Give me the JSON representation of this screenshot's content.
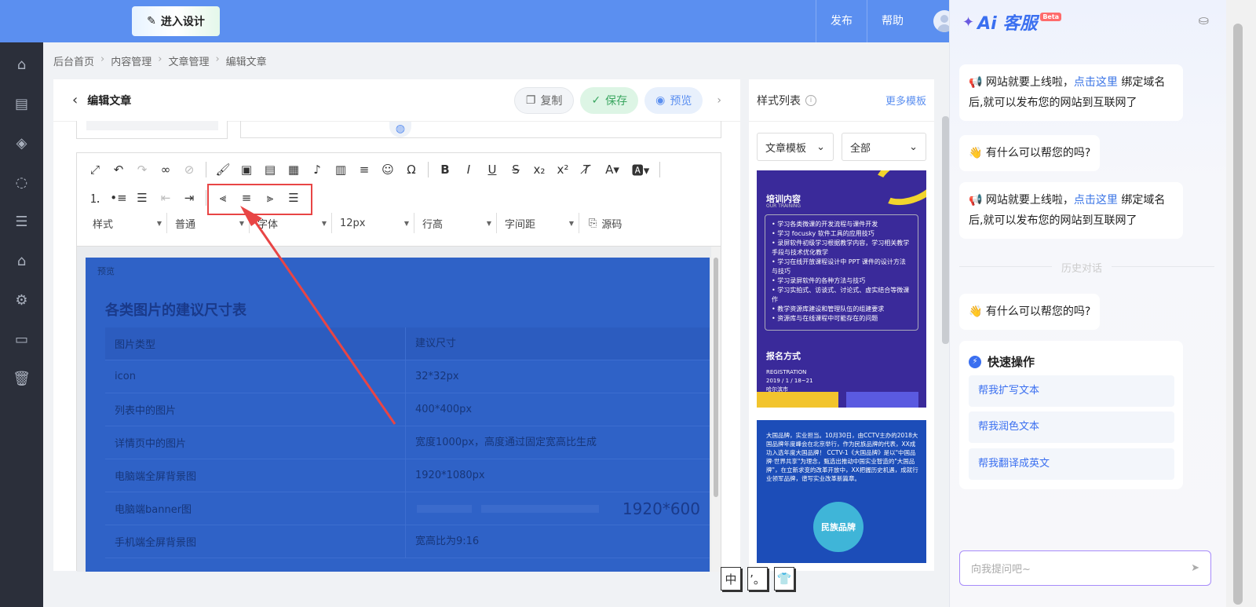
{
  "topbar": {
    "design_button": "进入设计",
    "links": [
      "发布",
      "帮助"
    ]
  },
  "sidebar": {
    "icons": [
      "home-icon",
      "document-icon",
      "layers-icon",
      "chat-icon",
      "list-icon",
      "shop-icon",
      "settings-icon",
      "terminal-icon",
      "trash-icon"
    ]
  },
  "breadcrumb": [
    "后台首页",
    "内容管理",
    "文章管理",
    "编辑文章"
  ],
  "editor": {
    "title": "编辑文章",
    "buttons": {
      "copy": "复制",
      "save": "保存",
      "preview": "预览"
    },
    "selects": [
      "样式",
      "普通",
      "字体",
      "12px",
      "行高",
      "字间距"
    ],
    "source": "源码"
  },
  "preview": {
    "label": "预览",
    "title": "各类图片的建议尺寸表",
    "headers": [
      "图片类型",
      "建议尺寸"
    ],
    "rows": [
      [
        "icon",
        "32*32px"
      ],
      [
        "列表中的图片",
        "400*400px"
      ],
      [
        "详情页中的图片",
        "宽度1000px，高度通过固定宽高比生成"
      ],
      [
        "电脑端全屏背景图",
        "1920*1080px"
      ],
      [
        "电脑端banner图",
        ""
      ],
      [
        "手机端全屏背景图",
        "宽高比为9:16"
      ]
    ],
    "banner_size": "1920*600"
  },
  "style_panel": {
    "title": "样式列表",
    "more": "更多模板",
    "select1": "文章模板",
    "select2": "全部",
    "tpl1": {
      "heading": "培训内容",
      "sub": "OUR TRAINING",
      "items": [
        "学习各类微课的开发流程与课件开发",
        "学习 focusky 软件工具的应用技巧",
        "录屏软件初级学习根据教学内容，学习相关教学手段与技术优化教学",
        "学习在线开放课程设计中 PPT 课件的设计方法与技巧",
        "学习录屏软件的各种方法与技巧",
        "学习实拍式、访谈式、讨论式、虚实结合等微课作",
        "教学资源库建设和管理队伍的组建要求",
        "资源库与在线课程中可能存在的问题"
      ],
      "heading2": "报名方式",
      "sub2": "REGISTRATION",
      "date": "2019 / 1 / 18~21",
      "city": "哈尔滨市"
    },
    "tpl2": {
      "text": "大国品牌，实业担当。10月30日，由CCTV主办的2018大国品牌年度峰会在北京举行，作为民族品牌的代表，XX成功入选年度大国品牌！ CCTV-1《大国品牌》是以\"中国品牌·世界共享\"为理念，甄选出推动中国实业智造的\"大国品牌\"，在立新求变的改革开放中，XX把握历史机遇，成就行业领军品牌，谱写实业改革新篇章。",
      "badge": "民族品牌"
    }
  },
  "ime": [
    "中",
    "’。",
    "👕"
  ],
  "ai": {
    "title": "Ai 客服",
    "beta": "Beta",
    "msg1_pre": "网站就要上线啦，",
    "msg1_link": "点击这里",
    "msg1_post": "绑定域名后,就可以发布您的网站到互联网了",
    "msg2": "有什么可以帮您的吗?",
    "history": "历史对话",
    "quick_title": "快速操作",
    "quick_items": [
      "帮我扩写文本",
      "帮我润色文本",
      "帮我翻译成英文"
    ],
    "input_placeholder": "向我提问吧~"
  },
  "colors": {
    "primary": "#5b8ff0",
    "save_green": "#3aa660",
    "highlight_red": "#e84545",
    "preview_blue": "#2f62c7"
  }
}
